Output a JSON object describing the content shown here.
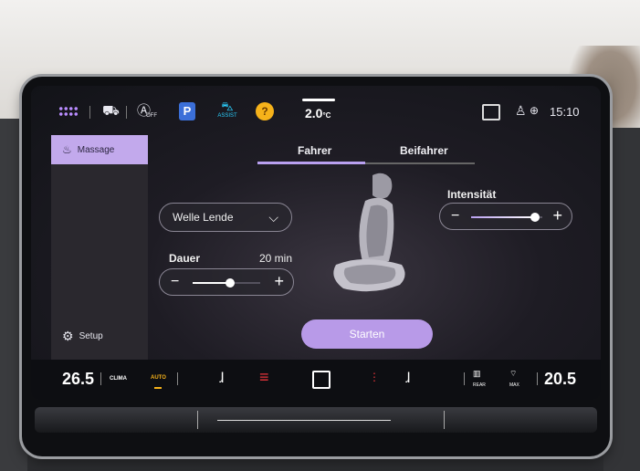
{
  "topbar": {
    "parking": "P",
    "assist_label": "ASSIST",
    "warning": "?",
    "temp": "2.0",
    "temp_unit": "°C",
    "clock": "15:10",
    "off_label": "OFF"
  },
  "sidebar": {
    "items": [
      {
        "label": "Massage",
        "icon": "seat-massage-icon",
        "active": true
      }
    ],
    "setup_label": "Setup"
  },
  "tabs": [
    {
      "label": "Fahrer",
      "active": true
    },
    {
      "label": "Beifahrer",
      "active": false
    }
  ],
  "program_dropdown": {
    "value": "Welle Lende"
  },
  "duration": {
    "label": "Dauer",
    "value": "20 min",
    "level": 0.55
  },
  "intensity": {
    "label": "Intensität",
    "level": 0.9
  },
  "start_button": {
    "label": "Starten"
  },
  "bottombar": {
    "left_temp": "26.5",
    "clima_label": "CLIMA",
    "auto_label": "AUTO",
    "rear_label": "REAR",
    "max_label": "MAX",
    "right_temp": "20.5"
  },
  "colors": {
    "accent": "#c2a9ec",
    "warning": "#f6b21a",
    "heat": "#e8343a"
  }
}
